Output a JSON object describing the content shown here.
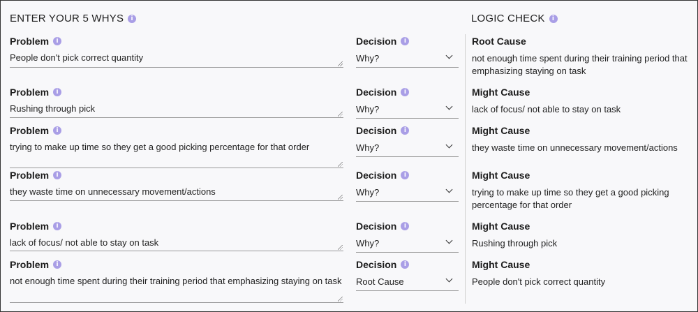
{
  "header": {
    "whys_title": "ENTER YOUR 5 WHYS",
    "logic_title": "LOGIC CHECK",
    "info_glyph": "i"
  },
  "rows": [
    {
      "problem_label": "Problem",
      "problem_text": "People don't pick correct quantity",
      "decision_label": "Decision",
      "decision_value": "Why?",
      "cause_label": "Root Cause",
      "cause_text": "not enough time spent during their training period that emphasizing staying on task"
    },
    {
      "problem_label": "Problem",
      "problem_text": "Rushing through pick",
      "decision_label": "Decision",
      "decision_value": "Why?",
      "cause_label": "Might Cause",
      "cause_text": "lack of focus/ not able to stay on task"
    },
    {
      "problem_label": "Problem",
      "problem_text": "trying to make up time so they get a good picking percentage for that order",
      "decision_label": "Decision",
      "decision_value": "Why?",
      "cause_label": "Might Cause",
      "cause_text": "they waste time on unnecessary movement/actions"
    },
    {
      "problem_label": "Problem",
      "problem_text": "they waste time on unnecessary movement/actions",
      "decision_label": "Decision",
      "decision_value": "Why?",
      "cause_label": "Might Cause",
      "cause_text": "trying to make up time so they get a good picking percentage for that order"
    },
    {
      "problem_label": "Problem",
      "problem_text": "lack of focus/ not able to stay on task",
      "decision_label": "Decision",
      "decision_value": "Why?",
      "cause_label": "Might Cause",
      "cause_text": "Rushing through pick"
    },
    {
      "problem_label": "Problem",
      "problem_text": "not enough time spent during their training period that emphasizing staying on task",
      "decision_label": "Decision",
      "decision_value": "Root Cause",
      "cause_label": "Might Cause",
      "cause_text": "People don't pick correct quantity"
    }
  ],
  "colors": {
    "info_badge": "#a99ee6",
    "background": "#f8f8fa"
  }
}
